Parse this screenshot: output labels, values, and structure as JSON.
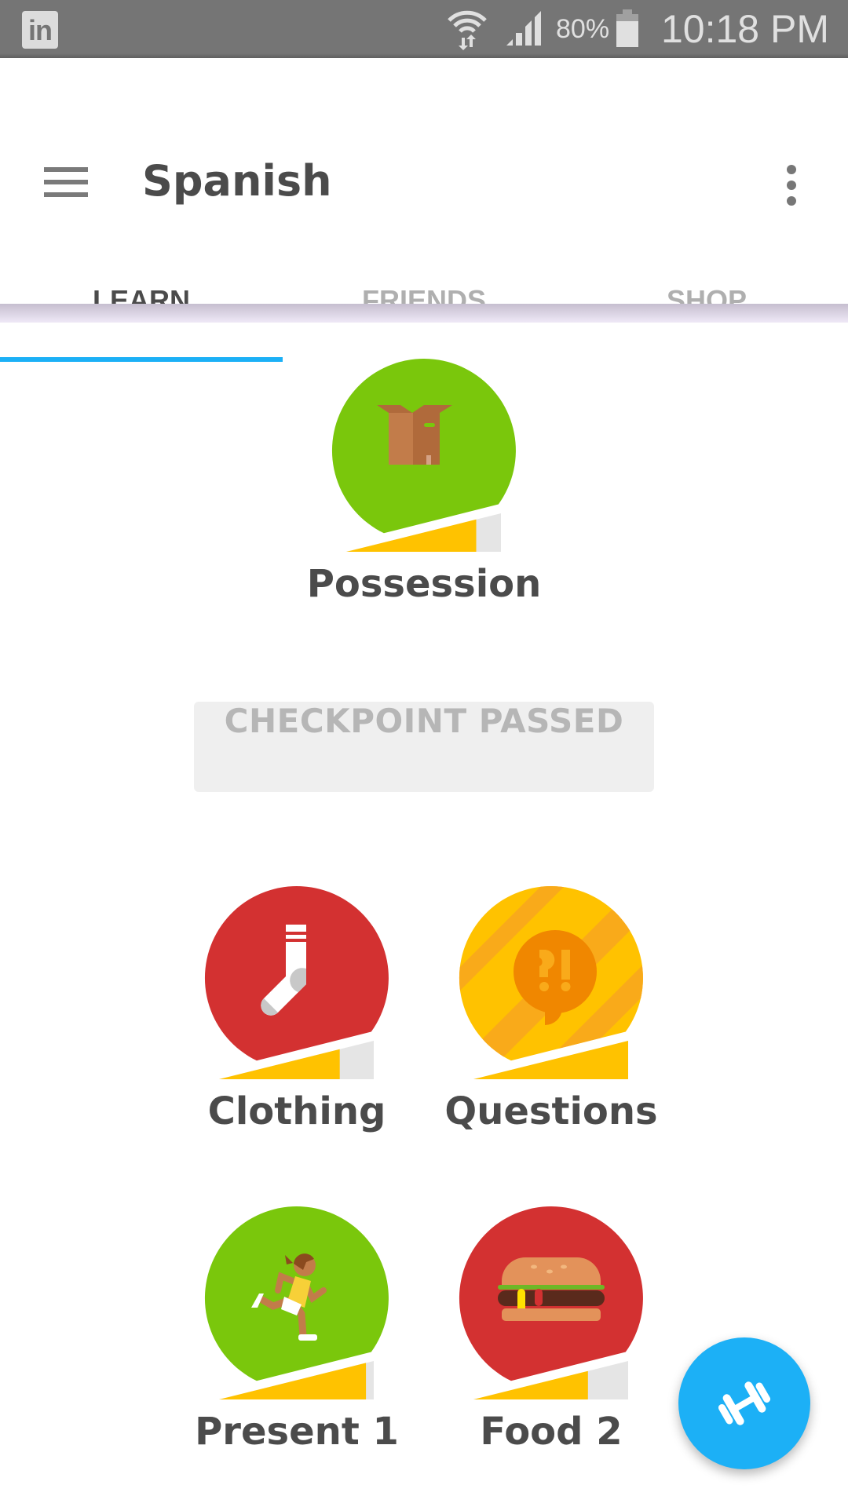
{
  "status_bar": {
    "notification_app": "in",
    "battery_percent": "80%",
    "battery_level": 0.8,
    "time": "10:18 PM"
  },
  "app_bar": {
    "title": "Spanish"
  },
  "tabs": [
    {
      "label": "LEARN",
      "active": true
    },
    {
      "label": "FRIENDS",
      "active": false
    },
    {
      "label": "SHOP",
      "active": false
    }
  ],
  "skills": [
    {
      "name": "Possession",
      "icon": "cardboard-box-icon",
      "color": "#7AC70C",
      "strength": 0.84
    },
    {
      "name": "Clothing",
      "icon": "sock-icon",
      "color": "#D33131",
      "strength": 0.78
    },
    {
      "name": "Questions",
      "icon": "question-exclamation-bubble-icon",
      "color": "#FFC200",
      "strength": 1.0
    },
    {
      "name": "Present 1",
      "icon": "running-person-icon",
      "color": "#7AC70C",
      "strength": 0.95
    },
    {
      "name": "Food 2",
      "icon": "hamburger-icon",
      "color": "#D33131",
      "strength": 0.74
    }
  ],
  "checkpoint": {
    "label": "CHECKPOINT PASSED"
  },
  "fab": {
    "icon": "dumbbell-icon"
  },
  "colors": {
    "accent": "#1CB0F6",
    "text": "#4B4B4B",
    "strength_bar": "#FFC200",
    "strength_bar_empty": "#E5E5E5"
  }
}
